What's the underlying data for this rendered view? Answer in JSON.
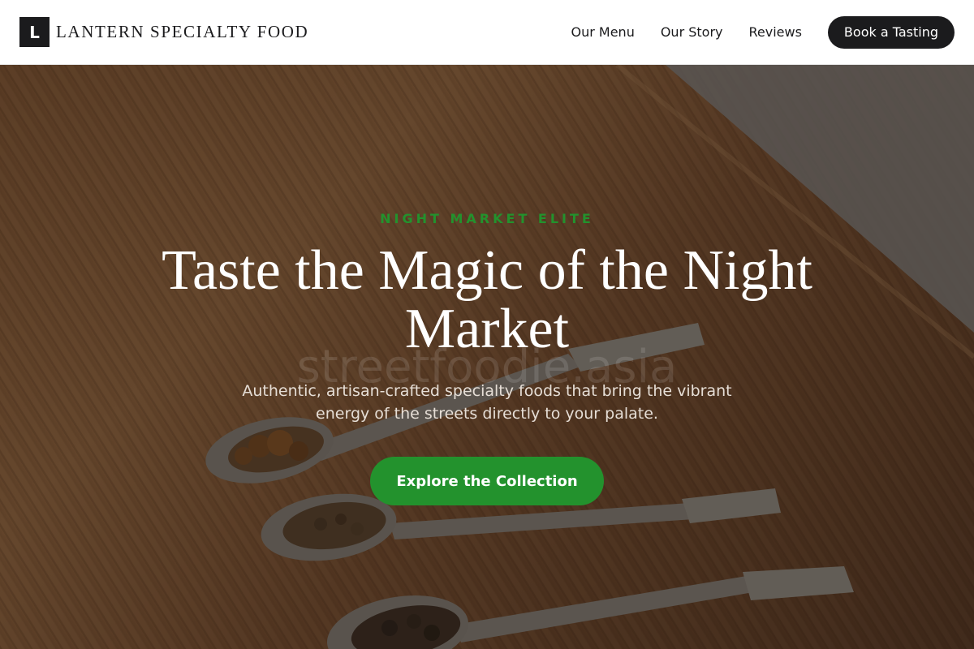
{
  "header": {
    "logo_letter": "L",
    "brand_name": "LANTERN SPECIALTY FOOD",
    "nav": [
      {
        "label": "Our Menu"
      },
      {
        "label": "Our Story"
      },
      {
        "label": "Reviews"
      }
    ],
    "cta_label": "Book a Tasting"
  },
  "hero": {
    "eyebrow": "NIGHT MARKET ELITE",
    "title": "Taste the Magic of the Night Market",
    "watermark": "streetfoodie.asia",
    "subtitle": "Authentic, artisan-crafted specialty foods that bring the vibrant energy of the streets directly to your palate.",
    "button_label": "Explore the Collection"
  },
  "colors": {
    "accent": "#23922d",
    "dark": "#1b1b1d",
    "header_bg": "#ffffff"
  },
  "icons": {
    "logo": "letter-l-mark"
  }
}
